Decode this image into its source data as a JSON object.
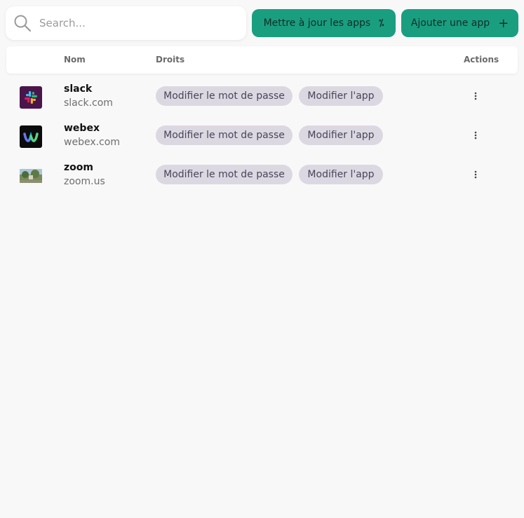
{
  "search": {
    "placeholder": "Search..."
  },
  "toolbar": {
    "update_label": "Mettre à jour les apps",
    "update_glyph": "⁒",
    "add_label": "Ajouter une app",
    "add_glyph": "+",
    "accent_color": "#1a9e80"
  },
  "table": {
    "headers": {
      "name": "Nom",
      "rights": "Droits",
      "actions": "Actions"
    },
    "rows": [
      {
        "name": "slack",
        "domain": "slack.com",
        "logo": "slack-logo",
        "rights": [
          "Modifier le mot de passe",
          "Modifier l'app"
        ]
      },
      {
        "name": "webex",
        "domain": "webex.com",
        "logo": "webex-logo",
        "rights": [
          "Modifier le mot de passe",
          "Modifier l'app"
        ]
      },
      {
        "name": "zoom",
        "domain": "zoom.us",
        "logo": "zoom-logo",
        "rights": [
          "Modifier le mot de passe",
          "Modifier l'app"
        ]
      }
    ]
  }
}
